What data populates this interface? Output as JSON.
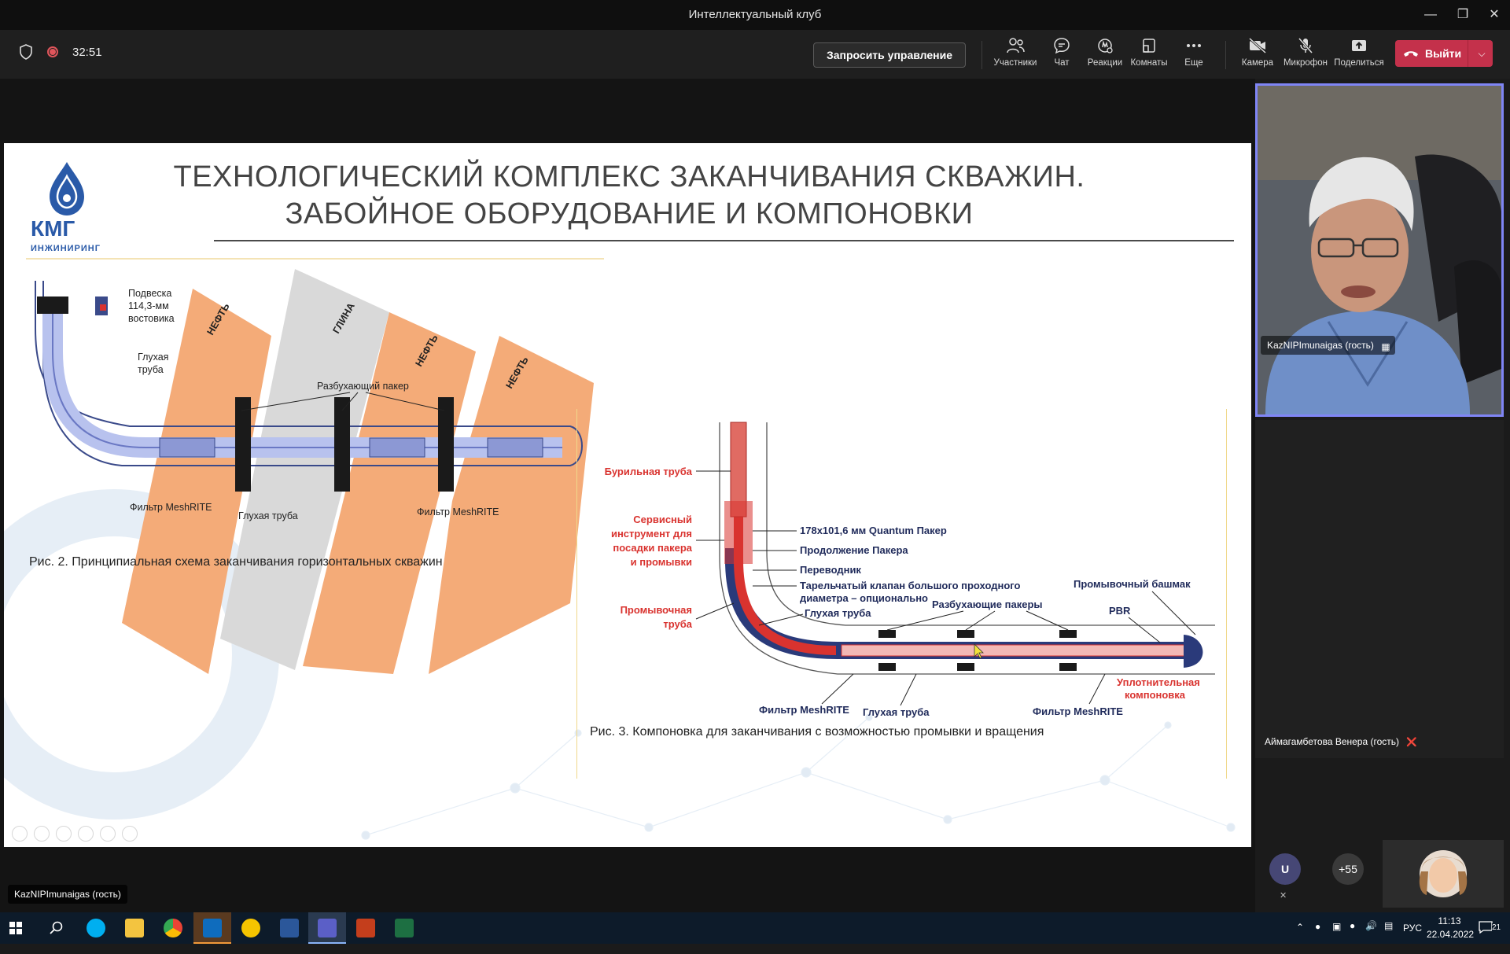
{
  "window": {
    "title": "Интеллектуальный клуб"
  },
  "meeting": {
    "elapsed": "32:51",
    "request_control": "Запросить управление",
    "toolbar": [
      {
        "id": "participants",
        "label": "Участники",
        "icon": "people-icon"
      },
      {
        "id": "chat",
        "label": "Чат",
        "icon": "chat-icon"
      },
      {
        "id": "reactions",
        "label": "Реакции",
        "icon": "reactions-icon"
      },
      {
        "id": "rooms",
        "label": "Комнаты",
        "icon": "rooms-icon"
      },
      {
        "id": "more",
        "label": "Еще",
        "icon": "more-icon"
      },
      {
        "id": "camera",
        "label": "Камера",
        "icon": "camera-off-icon"
      },
      {
        "id": "mic",
        "label": "Микрофон",
        "icon": "mic-off-icon"
      },
      {
        "id": "share",
        "label": "Поделиться",
        "icon": "share-icon"
      }
    ],
    "leave": "Выйти",
    "presenter_tag": "KazNIPImunaigas (гость)"
  },
  "slide": {
    "title_line1": "ТЕХНОЛОГИЧЕСКИЙ КОМПЛЕКС ЗАКАНЧИВАНИЯ СКВАЖИН.",
    "title_line2": "ЗАБОЙНОЕ ОБОРУДОВАНИЕ И КОМПОНОВКИ",
    "logo_main": "КМГ",
    "logo_sub": "ИНЖИНИРИНГ",
    "fig2": {
      "caption": "Рис. 2. Принципиальная схема заканчивания горизонтальных скважин",
      "layers": [
        "НЕФТЬ",
        "ГЛИНА",
        "НЕФТЬ",
        "НЕФТЬ"
      ],
      "labels": {
        "hanger_1": "Подвеска",
        "hanger_2": "114,3-мм",
        "hanger_3": "востовика",
        "blank_1": "Глухая",
        "blank_2": "труба",
        "packer": "Разбухающий пакер",
        "filter_left": "Фильтр MeshRITE",
        "blank_bottom": "Глухая труба",
        "filter_right": "Фильтр MeshRITE"
      }
    },
    "fig3": {
      "caption": "Рис. 3. Компоновка для заканчивания с возможностью промывки и вращения",
      "labels": {
        "drill_pipe": "Бурильная труба",
        "service_1": "Сервисный",
        "service_2": "инструмент для",
        "service_3": "посадки пакера",
        "service_4": "и промывки",
        "wash_1": "Промывочная",
        "wash_2": "труба",
        "quantum": "178x101,6 мм Quantum Пакер",
        "packer_ext": "Продолжение Пакера",
        "crossover": "Переводник",
        "valve_1": "Тарельчатый клапан большого проходного",
        "valve_2": "диаметра – опционально",
        "blank": "Глухая труба",
        "swell": "Разбухающие пакеры",
        "shoe": "Промывочный башмак",
        "pbr": "PBR",
        "seal_1": "Уплотнительная",
        "seal_2": "компоновка",
        "filter_left": "Фильтр MeshRITE",
        "blank_bottom": "Глухая труба",
        "filter_right": "Фильтр MeshRITE"
      }
    }
  },
  "participants": {
    "speaker_name": "KazNIPImunaigas (гость)",
    "second_name": "Аймагамбетова Венера (гость)",
    "avatar_initial": "U",
    "more_count": "+55"
  },
  "taskbar": {
    "lang": "РУС",
    "time": "11:13",
    "date": "22.04.2022",
    "notifications": "21"
  },
  "colors": {
    "accent": "#7f85f5",
    "leave": "#c4314b",
    "oil": "#f4ab78",
    "clay": "#d9d9d9",
    "pipe_red": "#d9332f",
    "pipe_blue": "#2a3a7a"
  }
}
